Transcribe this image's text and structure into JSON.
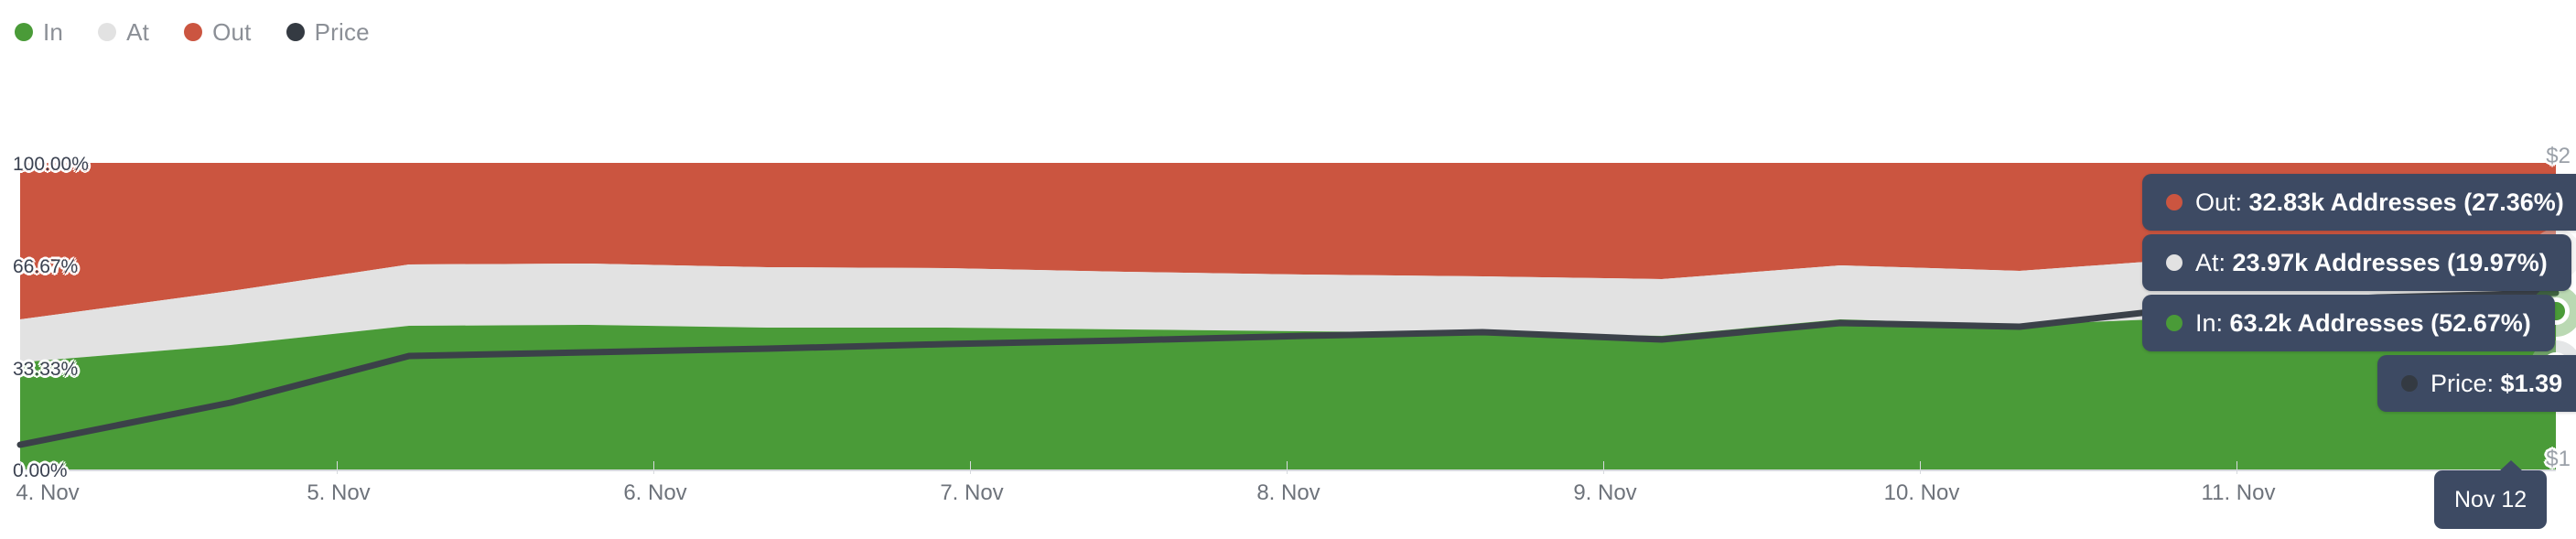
{
  "legend": {
    "items": [
      {
        "label": "In",
        "color": "#4a9b38",
        "name": "legend-item-in"
      },
      {
        "label": "At",
        "color": "#e2e2e2",
        "name": "legend-item-at"
      },
      {
        "label": "Out",
        "color": "#cb5540",
        "name": "legend-item-out"
      },
      {
        "label": "Price",
        "color": "#343a42",
        "name": "legend-item-price"
      }
    ]
  },
  "axes": {
    "y_left_labels": [
      "100.00%",
      "66.67%",
      "33.33%",
      "0.00%"
    ],
    "y_right_labels": [
      "$2",
      "$1"
    ],
    "x_labels": [
      "4. Nov",
      "5. Nov",
      "6. Nov",
      "7. Nov",
      "8. Nov",
      "9. Nov",
      "10. Nov",
      "11. Nov"
    ]
  },
  "crosshair": {
    "x_label": "Nov 12"
  },
  "tooltips": [
    {
      "series": "Out",
      "label": "Out:",
      "value": "32.83k Addresses (27.36%)",
      "color": "#cb5540"
    },
    {
      "series": "At",
      "label": "At:",
      "value": "23.97k Addresses (19.97%)",
      "color": "#e2e2e2"
    },
    {
      "series": "In",
      "label": "In:",
      "value": "63.2k Addresses (52.67%)",
      "color": "#4a9b38"
    },
    {
      "series": "Price",
      "label": "Price:",
      "value": "$1.39",
      "color": "#343a42"
    }
  ],
  "chart_data": {
    "type": "area",
    "title": "",
    "subtitle": "",
    "xlabel": "",
    "ylabel": "",
    "stacked": true,
    "normalized": true,
    "grid": false,
    "legend_position": "top-left",
    "ylim": [
      0,
      100
    ],
    "ytick_labels": [
      "0.00%",
      "33.33%",
      "66.67%",
      "100.00%"
    ],
    "ytick_values": [
      0,
      33.33,
      66.67,
      100
    ],
    "y2_label": "Price",
    "y2lim": [
      1,
      2
    ],
    "y2tick_labels": [
      "$1",
      "$2"
    ],
    "y2tick_values": [
      1,
      2
    ],
    "x": [
      "4. Nov",
      "5. Nov",
      "6. Nov",
      "7. Nov",
      "8. Nov",
      "9. Nov",
      "10. Nov",
      "11. Nov",
      "Nov 12"
    ],
    "series": [
      {
        "name": "In",
        "color": "#4a9b38",
        "stack": true,
        "values": [
          37.0,
          43.0,
          47.5,
          47.8,
          48.2,
          50.0,
          49.6,
          51.6,
          52.67
        ]
      },
      {
        "name": "At",
        "color": "#e2e2e2",
        "stack": true,
        "values": [
          9.5,
          12.0,
          17.0,
          16.8,
          16.6,
          17.8,
          18.4,
          19.2,
          19.97
        ]
      },
      {
        "name": "Out",
        "color": "#cb5540",
        "stack": true,
        "values": [
          53.5,
          45.0,
          35.5,
          35.4,
          35.2,
          32.2,
          32.0,
          29.2,
          27.36
        ]
      },
      {
        "name": "Price",
        "color": "#343a42",
        "type": "line",
        "axis": "y2",
        "values": [
          1.08,
          1.22,
          1.31,
          1.315,
          1.32,
          1.335,
          1.33,
          1.375,
          1.39
        ]
      }
    ],
    "highlight_point": {
      "x": "Nov 12",
      "In": "63.2k Addresses (52.67%)",
      "At": "23.97k Addresses (19.97%)",
      "Out": "32.83k Addresses (27.36%)",
      "Price": "$1.39"
    }
  }
}
